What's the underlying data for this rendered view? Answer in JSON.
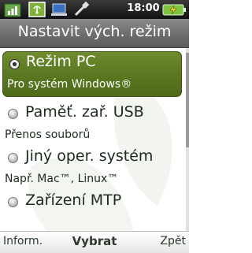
{
  "status_bar": {
    "time": "18:00",
    "icons": [
      "signal-icon",
      "network-icon",
      "usb-computer-icon",
      "usb-cable-icon",
      "battery-charging-icon"
    ]
  },
  "screen": {
    "title": "Nastavit vých. režim"
  },
  "options": [
    {
      "label": "Režim PC",
      "sublabel": "Pro systém Windows®",
      "selected": true
    },
    {
      "label": "Paměť. zař. USB",
      "sublabel": "Přenos souborů",
      "selected": false
    },
    {
      "label": "Jiný oper. systém",
      "sublabel": "Např. Mac™, Linux™",
      "selected": false
    },
    {
      "label": "Zařízení MTP",
      "sublabel": "",
      "selected": false
    }
  ],
  "softkeys": {
    "left": "Inform.",
    "center": "Vybrat",
    "right": "Zpět"
  },
  "colors": {
    "selection": "#5c7a22",
    "title_bar": "#6d6d6d",
    "status_bar": "#111111",
    "text": "#1e2a1e"
  }
}
